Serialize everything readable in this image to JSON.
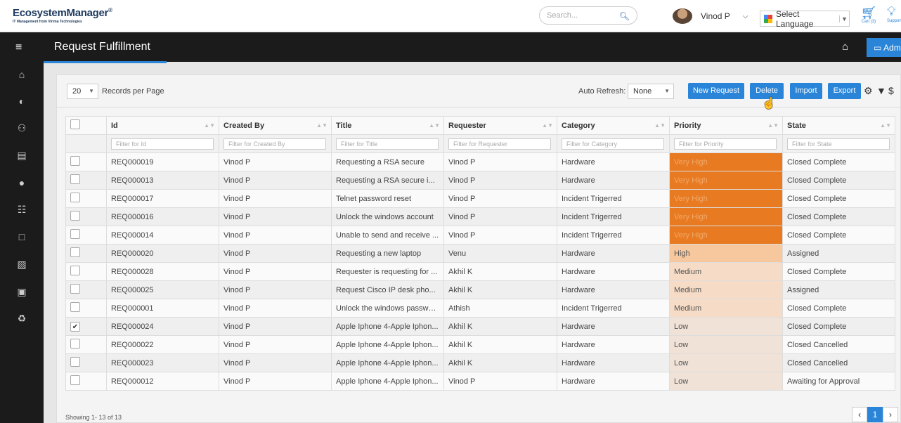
{
  "app": {
    "logo_name": "EcosystemManager",
    "logo_mark": "®",
    "logo_tagline": "IT Management from Virima Technologies"
  },
  "header": {
    "search_placeholder": "Search...",
    "user_name": "Vinod P",
    "language_label": "Select Language",
    "cart_label": "Cart (3)",
    "support_label": "Support"
  },
  "nav": {
    "page_title": "Request Fulfillment",
    "admin_label": "Admin"
  },
  "toolbar": {
    "records_per_page_value": "20",
    "records_per_page_label": "Records per Page",
    "auto_refresh_label": "Auto Refresh:",
    "auto_refresh_value": "None",
    "new_request": "New Request",
    "delete": "Delete",
    "import": "Import",
    "export": "Export"
  },
  "columns": [
    "Id",
    "Created By",
    "Title",
    "Requester",
    "Category",
    "Priority",
    "State"
  ],
  "filters": [
    "Filter for Id",
    "Filter for Created By",
    "Filter for Title",
    "Filter for Requester",
    "Filter for Category",
    "Filter for Priority",
    "Filter for State"
  ],
  "rows": [
    {
      "checked": false,
      "id": "REQ000019",
      "created_by": "Vinod P",
      "title": "Requesting a RSA secure",
      "requester": "Vinod P",
      "category": "Hardware",
      "priority": "Very High",
      "state": "Closed Complete"
    },
    {
      "checked": false,
      "id": "REQ000013",
      "created_by": "Vinod P",
      "title": "Requesting a RSA secure i...",
      "requester": "Vinod P",
      "category": "Hardware",
      "priority": "Very High",
      "state": "Closed Complete"
    },
    {
      "checked": false,
      "id": "REQ000017",
      "created_by": "Vinod P",
      "title": "Telnet password reset",
      "requester": "Vinod P",
      "category": "Incident Trigerred",
      "priority": "Very High",
      "state": "Closed Complete"
    },
    {
      "checked": false,
      "id": "REQ000016",
      "created_by": "Vinod P",
      "title": "Unlock the windows account",
      "requester": "Vinod P",
      "category": "Incident Trigerred",
      "priority": "Very High",
      "state": "Closed Complete"
    },
    {
      "checked": false,
      "id": "REQ000014",
      "created_by": "Vinod P",
      "title": "Unable to send and receive ...",
      "requester": "Vinod P",
      "category": "Incident Trigerred",
      "priority": "Very High",
      "state": "Closed Complete"
    },
    {
      "checked": false,
      "id": "REQ000020",
      "created_by": "Vinod P",
      "title": "Requesting a new laptop",
      "requester": "Venu",
      "category": "Hardware",
      "priority": "High",
      "state": "Assigned"
    },
    {
      "checked": false,
      "id": "REQ000028",
      "created_by": "Vinod P",
      "title": "Requester is requesting for ...",
      "requester": "Akhil K",
      "category": "Hardware",
      "priority": "Medium",
      "state": "Closed Complete"
    },
    {
      "checked": false,
      "id": "REQ000025",
      "created_by": "Vinod P",
      "title": "Request Cisco IP desk pho...",
      "requester": "Akhil K",
      "category": "Hardware",
      "priority": "Medium",
      "state": "Assigned"
    },
    {
      "checked": false,
      "id": "REQ000001",
      "created_by": "Vinod P",
      "title": "Unlock the windows password",
      "requester": "Athish",
      "category": "Incident Trigerred",
      "priority": "Medium",
      "state": "Closed Complete"
    },
    {
      "checked": true,
      "id": "REQ000024",
      "created_by": "Vinod P",
      "title": "Apple Iphone 4-Apple Iphon...",
      "requester": "Akhil K",
      "category": "Hardware",
      "priority": "Low",
      "state": "Closed Complete"
    },
    {
      "checked": false,
      "id": "REQ000022",
      "created_by": "Vinod P",
      "title": "Apple Iphone 4-Apple Iphon...",
      "requester": "Akhil K",
      "category": "Hardware",
      "priority": "Low",
      "state": "Closed Cancelled"
    },
    {
      "checked": false,
      "id": "REQ000023",
      "created_by": "Vinod P",
      "title": "Apple Iphone 4-Apple Iphon...",
      "requester": "Akhil K",
      "category": "Hardware",
      "priority": "Low",
      "state": "Closed Cancelled"
    },
    {
      "checked": false,
      "id": "REQ000012",
      "created_by": "Vinod P",
      "title": "Apple Iphone 4-Apple Iphon...",
      "requester": "Vinod P",
      "category": "Hardware",
      "priority": "Low",
      "state": "Awaiting for Approval"
    }
  ],
  "footer": {
    "showing": "Showing 1- 13 of 13",
    "current_page": "1"
  },
  "priority_colors": {
    "Very High": "#e87a22",
    "High": "#f7c79d",
    "Medium": "#f6dcc6",
    "Low": "#f0e2d6"
  },
  "accent_color": "#2a85d8",
  "sidebar_icons": [
    "home-icon",
    "dashboard-icon",
    "binoculars-icon",
    "calendar-grid-icon",
    "user-icon",
    "sitemap-icon",
    "calendar-icon",
    "book-icon",
    "briefcase-icon",
    "recycle-icon"
  ]
}
